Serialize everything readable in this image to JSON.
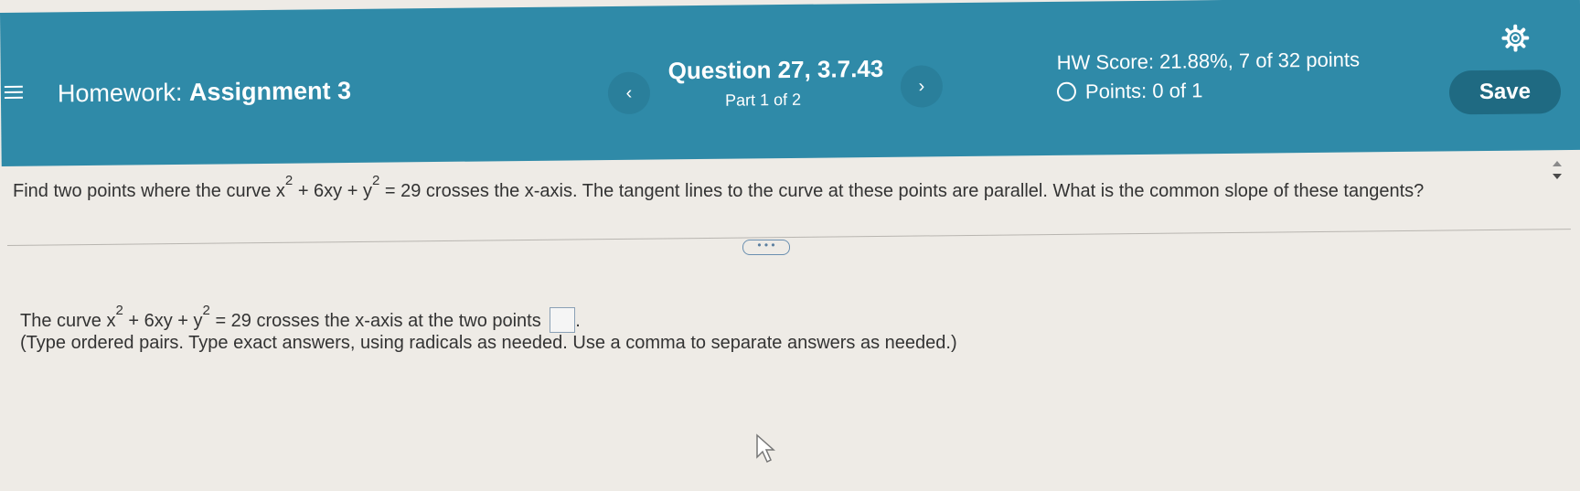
{
  "header": {
    "menu_icon": "hamburger-menu-icon",
    "homework_prefix": "Homework:",
    "assignment_title": "Assignment 3",
    "question_title": "Question 27, 3.7.43",
    "part": "Part 1 of 2",
    "prev_symbol": "‹",
    "next_symbol": "›",
    "hw_score": "HW Score: 21.88%, 7 of 32 points",
    "points": "Points: 0 of 1",
    "save_label": "Save",
    "settings_icon": "gear-icon",
    "background_color": "#2f8aa8"
  },
  "question": {
    "prefix": "Find two points where the curve ",
    "x": "x",
    "exp1": "2",
    "mid": " + 6xy + y",
    "exp2": "2",
    "suffix": " = 29 crosses the x-axis. The tangent lines to the curve at these points are parallel. What is the common slope of these tangents?"
  },
  "expand_label": "• • •",
  "answer": {
    "prefix": "The curve ",
    "x": "x",
    "exp1": "2",
    "mid": " + 6xy + y",
    "exp2": "2",
    "suffix": " = 29 crosses the x-axis at the two points ",
    "end": ".",
    "instructions": "(Type ordered pairs. Type exact answers, using radicals as needed. Use a comma to separate answers as needed.)"
  }
}
